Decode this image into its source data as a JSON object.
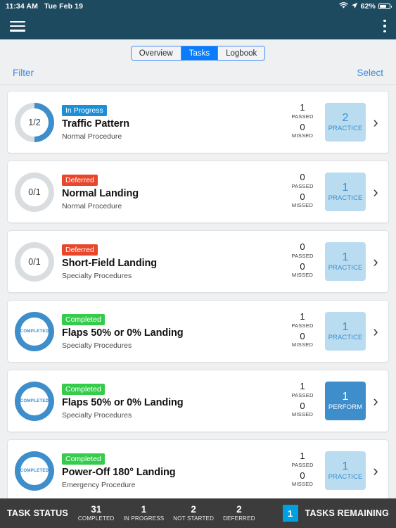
{
  "statusbar": {
    "time": "11:34 AM",
    "date": "Tue Feb 19",
    "wifi_icon": "wifi-icon",
    "location_icon": "location-arrow-icon",
    "battery_percent": "62%",
    "battery_icon": "battery-icon"
  },
  "navbar": {
    "menu_icon": "hamburger-menu-icon",
    "overflow_icon": "kebab-menu-icon",
    "background": "#1e4a5f"
  },
  "segmented": {
    "options": [
      "Overview",
      "Tasks",
      "Logbook"
    ],
    "selected": "Tasks",
    "accent": "#0a7cfb"
  },
  "toolbar": {
    "filter_label": "Filter",
    "select_label": "Select",
    "link_color": "#3a8ae0"
  },
  "colors": {
    "in_progress": "#1c8fd6",
    "deferred": "#e8472c",
    "completed": "#35cc4b",
    "ring_blue": "#3e8ecc",
    "ring_gray": "#dadde0",
    "practice_bg": "#b9dcf1",
    "perform_bg": "#3e8ecc"
  },
  "stat_labels": {
    "passed": "PASSED",
    "missed": "MISSED"
  },
  "completed_ring_text": "COMPLETED",
  "tasks": [
    {
      "status": "In Progress",
      "status_type": "in-progress",
      "title": "Traffic Pattern",
      "subtitle": "Normal Procedure",
      "progress_text": "1/2",
      "progress_done": 1,
      "progress_total": 2,
      "passed": "1",
      "missed": "0",
      "action_count": "2",
      "action_label": "PRACTICE",
      "action_type": "practice"
    },
    {
      "status": "Deferred",
      "status_type": "deferred",
      "title": "Normal Landing",
      "subtitle": "Normal Procedure",
      "progress_text": "0/1",
      "progress_done": 0,
      "progress_total": 1,
      "passed": "0",
      "missed": "0",
      "action_count": "1",
      "action_label": "PRACTICE",
      "action_type": "practice"
    },
    {
      "status": "Deferred",
      "status_type": "deferred",
      "title": "Short-Field Landing",
      "subtitle": "Specialty Procedures",
      "progress_text": "0/1",
      "progress_done": 0,
      "progress_total": 1,
      "passed": "0",
      "missed": "0",
      "action_count": "1",
      "action_label": "PRACTICE",
      "action_type": "practice"
    },
    {
      "status": "Completed",
      "status_type": "completed",
      "title": "Flaps 50% or 0% Landing",
      "subtitle": "Specialty Procedures",
      "progress_text": "COMPLETED",
      "progress_done": 1,
      "progress_total": 1,
      "passed": "1",
      "missed": "0",
      "action_count": "1",
      "action_label": "PRACTICE",
      "action_type": "practice"
    },
    {
      "status": "Completed",
      "status_type": "completed",
      "title": "Flaps 50% or 0% Landing",
      "subtitle": "Specialty Procedures",
      "progress_text": "COMPLETED",
      "progress_done": 1,
      "progress_total": 1,
      "passed": "1",
      "missed": "0",
      "action_count": "1",
      "action_label": "PERFORM",
      "action_type": "perform"
    },
    {
      "status": "Completed",
      "status_type": "completed",
      "title": "Power-Off 180° Landing",
      "subtitle": "Emergency Procedure",
      "progress_text": "COMPLETED",
      "progress_done": 1,
      "progress_total": 1,
      "passed": "1",
      "missed": "0",
      "action_count": "1",
      "action_label": "PRACTICE",
      "action_type": "practice"
    }
  ],
  "bottombar": {
    "title": "TASK STATUS",
    "stats": [
      {
        "value": "31",
        "label": "COMPLETED"
      },
      {
        "value": "1",
        "label": "IN PROGRESS"
      },
      {
        "value": "2",
        "label": "NOT STARTED"
      },
      {
        "value": "2",
        "label": "DEFERRED"
      }
    ],
    "remaining_count": "1",
    "remaining_label": "TASKS REMAINING",
    "badge_color": "#00a0e0"
  }
}
